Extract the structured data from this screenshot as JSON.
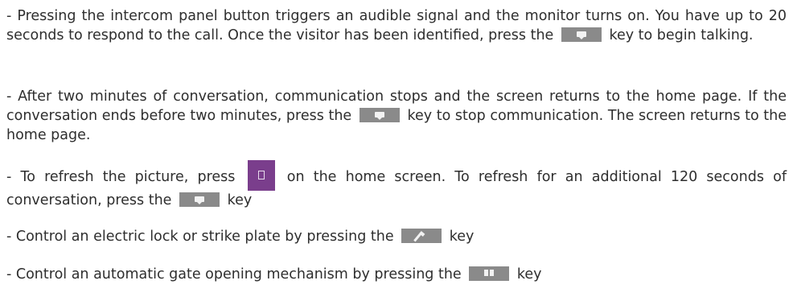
{
  "paragraphs": {
    "p1": {
      "before": "- Pressing the intercom panel button triggers an audible signal and the monitor turns on. You have up to 20 seconds to respond to the call. Once the visitor has been identified, press the",
      "after": "key to begin talking."
    },
    "p2": {
      "before": "- After two minutes of conversation, communication stops and the screen returns to the home page. If the conversation ends before two minutes, press the",
      "after": "key to stop communication. The screen returns to the home page."
    },
    "p3": {
      "before": "- To refresh the picture, press",
      "middle": "on the home screen. To refresh for an additional 120 seconds of conversation, press the",
      "after": "key"
    },
    "p4": {
      "before": "- Control an electric lock or strike plate by pressing the",
      "after": "key"
    },
    "p5": {
      "before": "- Control an automatic gate opening mechanism by pressing the",
      "after": "key"
    }
  },
  "icons": {
    "talk_key": "talk-icon",
    "refresh_key": "refresh-icon",
    "lock_key": "lock-release-icon",
    "gate_key": "gate-open-icon"
  },
  "colors": {
    "text": "#2e2e2e",
    "key_gray": "#8a8a8a",
    "key_purple": "#7a3e8c"
  }
}
